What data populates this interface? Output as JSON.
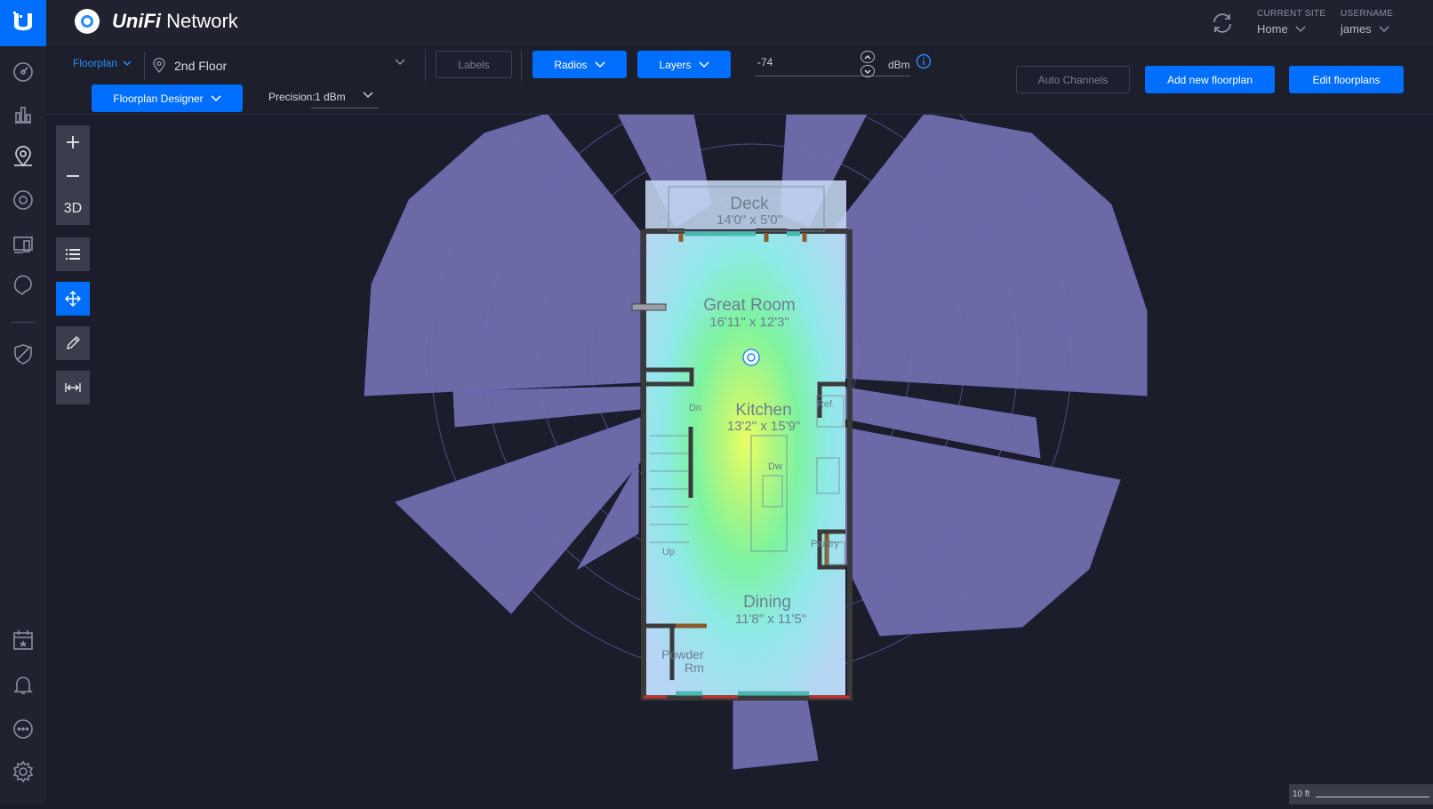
{
  "app": {
    "brand_prefix": "UniFi",
    "brand_suffix": "Network"
  },
  "header": {
    "site_label": "CURRENT SITE",
    "site_value": "Home",
    "user_label": "USERNAME",
    "user_value": "james"
  },
  "toolbar": {
    "floorplan_dropdown": "Floorplan",
    "floor_name": "2nd Floor",
    "labels_button": "Labels",
    "radios_button": "Radios",
    "layers_button": "Layers",
    "dbm_value": "-74",
    "dbm_unit": "dBm",
    "auto_channels_button": "Auto Channels",
    "add_floorplan_button": "Add new floorplan",
    "edit_floorplans_button": "Edit floorplans",
    "designer_button": "Floorplan Designer",
    "precision_label": "Precision:",
    "precision_value": "1 dBm"
  },
  "tools": {
    "three_d_label": "3D"
  },
  "map": {
    "rooms": [
      {
        "name": "Deck",
        "dims": "14'0\" x 5'0\""
      },
      {
        "name": "Great Room",
        "dims": "16'11\" x 12'3\""
      },
      {
        "name": "Kitchen",
        "dims": "13'2\" x 15'9\""
      },
      {
        "name": "Dining",
        "dims": "11'8\" x 11'5\""
      },
      {
        "name": "Powder",
        "dims": "Rm"
      }
    ],
    "fixture_labels": [
      "Dn",
      "Ref.",
      "Dw",
      "Up",
      "Pantry"
    ],
    "scale_label": "10 ft"
  },
  "colors": {
    "accent": "#006fff",
    "sidebar": "#20222f",
    "background": "#1b1d2b"
  }
}
